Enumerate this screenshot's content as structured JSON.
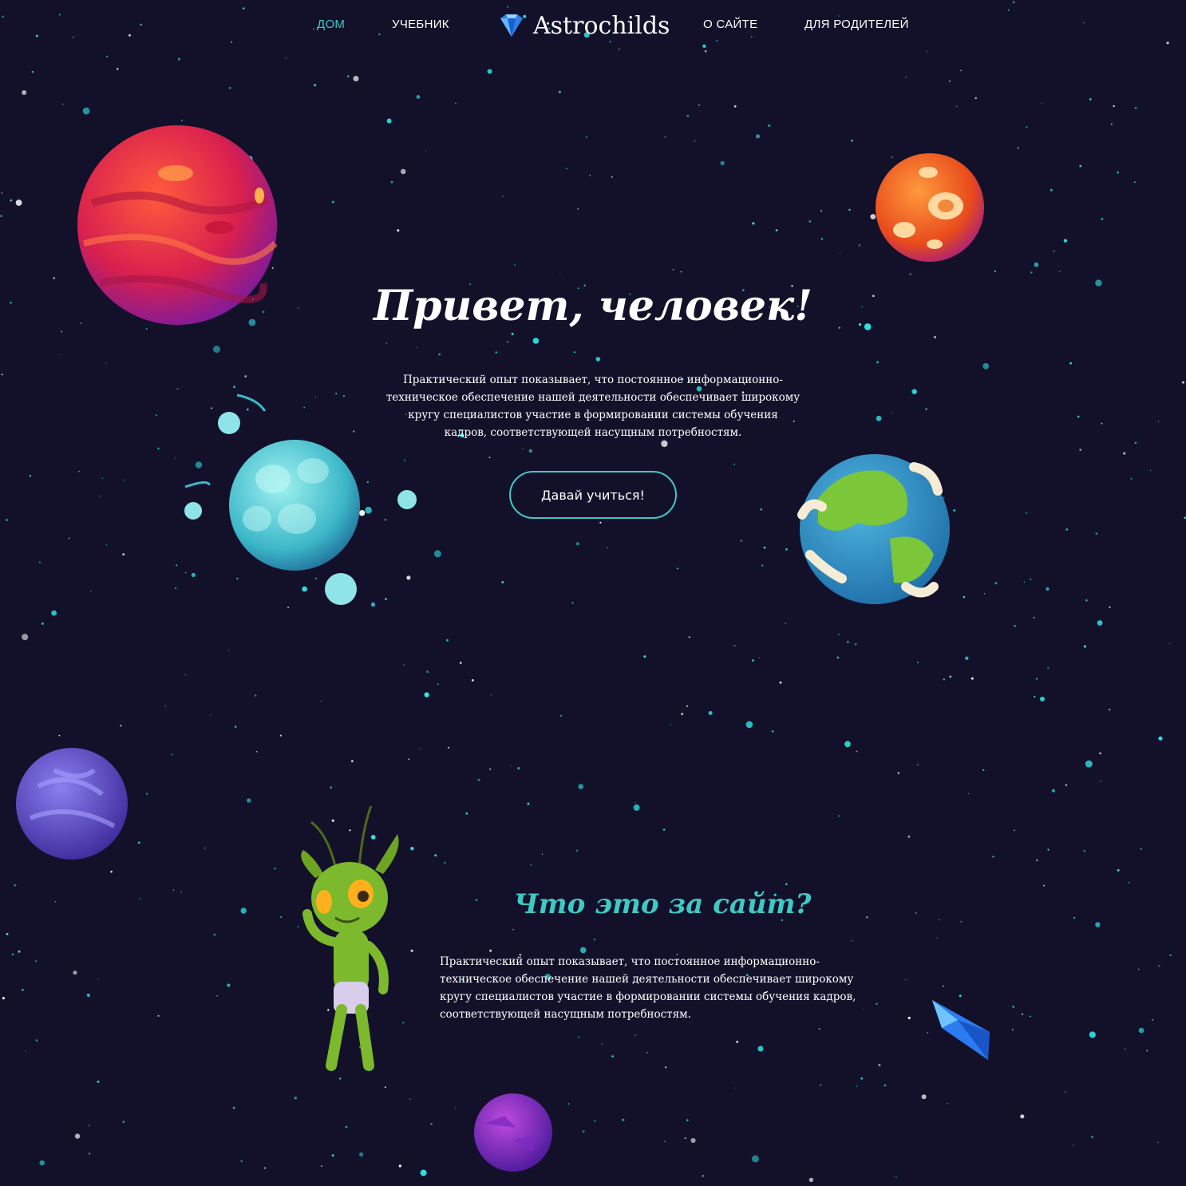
{
  "nav": {
    "home": "ДОМ",
    "textbook": "УЧЕБНИК",
    "logo": "Astrochilds",
    "about": "О САЙТЕ",
    "parents": "ДЛЯ РОДИТЕЛЕЙ",
    "active_color": "#3ec9c4"
  },
  "hero": {
    "title": "Привет, человек!",
    "text": "Практический опыт показывает, что постоянное информационно-техническое обеспечение нашей деятельности обеспечивает широкому кругу специалистов участие в формировании системы обучения кадров, соответствующей насущным потребностям.",
    "button": "Давай учиться!"
  },
  "about": {
    "title": "Что это за сайт?",
    "text": "Практический опыт показывает, что постоянное информационно-техническое обеспечение нашей деятельности обеспечивает широкому кругу специалистов участие в формировании системы обучения кадров, соответствующей насущным потребностям."
  },
  "icons": {
    "logo": "crystal-icon",
    "decor": [
      "red-planet",
      "orange-planet",
      "cyan-planet",
      "earth-planet",
      "purple-planet",
      "violet-planet",
      "alien",
      "blue-crystal"
    ]
  },
  "colors": {
    "background": "#13102a",
    "accent": "#3ec9c4",
    "star": "#2ee6e6"
  }
}
